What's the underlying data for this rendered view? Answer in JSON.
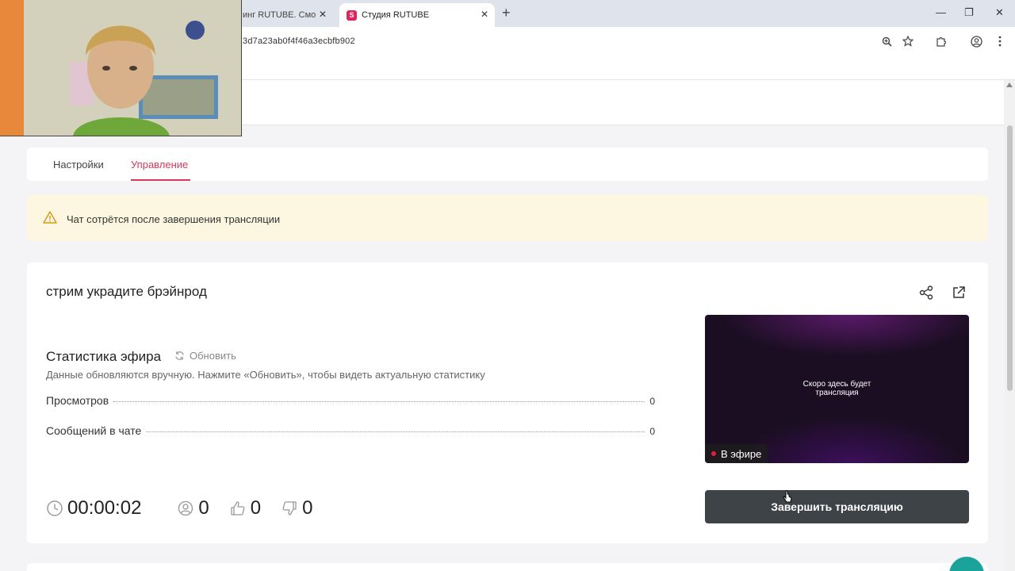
{
  "browser": {
    "tabs": [
      {
        "title": "инг RUTUBE. Смотре",
        "active": false
      },
      {
        "title": "Студия RUTUBE",
        "active": true
      }
    ],
    "url": "3d7a23ab0f4f46a3ecbfb902",
    "window_controls": {
      "minimize": "—",
      "maximize": "❐",
      "close": "✕"
    }
  },
  "page_tabs": [
    {
      "label": "Настройки",
      "active": false
    },
    {
      "label": "Управление",
      "active": true
    }
  ],
  "notice": {
    "text": "Чат сотрётся после завершения трансляции",
    "icon": "warning-icon"
  },
  "stream": {
    "title": "стрим украдите брэйнрод",
    "stats_title": "Статистика эфира",
    "refresh_label": "Обновить",
    "stats_hint": "Данные обновляются вручную. Нажмите «Обновить», чтобы видеть актуальную статистику",
    "stats": [
      {
        "label": "Просмотров",
        "value": "0"
      },
      {
        "label": "Сообщений в чате",
        "value": "0"
      }
    ],
    "timer": "00:00:02",
    "viewers": "0",
    "likes": "0",
    "dislikes": "0",
    "preview_text_line1": "Скоро здесь будет",
    "preview_text_line2": "трансляция",
    "live_label": "В эфире",
    "end_button": "Завершить трансляцию"
  },
  "colors": {
    "accent": "#d6395a",
    "notice_bg": "#fdf7e2",
    "end_button_bg": "#3d4347",
    "live_dot": "#e02040",
    "chat_fab": "#1aa39a"
  }
}
